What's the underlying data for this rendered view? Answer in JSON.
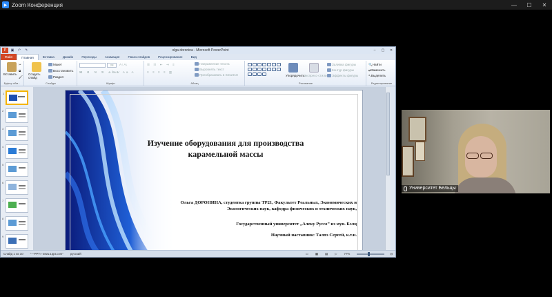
{
  "zoom": {
    "title": "Zoom Конференция",
    "minimize": "—",
    "maximize": "☐",
    "close": "✕"
  },
  "ppt": {
    "title": "olga doronina - Microsoft PowerPoint",
    "tabs": [
      {
        "label": "Файл"
      },
      {
        "label": "Главная"
      },
      {
        "label": "Вставка"
      },
      {
        "label": "Дизайн"
      },
      {
        "label": "Переходы"
      },
      {
        "label": "Анимация"
      },
      {
        "label": "Показ слайдов"
      },
      {
        "label": "Рецензирование"
      },
      {
        "label": "Вид"
      }
    ],
    "ribbon": {
      "paste": "Вставить",
      "create_slide": "Создать слайд",
      "layout": "Макет",
      "reset": "Восстановить",
      "section": "Раздел",
      "font_size": "28",
      "text_direction": "Направление текста",
      "align_text": "Выровнять текст",
      "smartart": "Преобразовать в SmartArt",
      "arrange": "Упорядочить",
      "quick_styles": "Экспресс-стили",
      "shape_fill": "Заливка фигуры",
      "shape_outline": "Контур фигуры",
      "shape_effects": "Эффекты фигуры",
      "find": "Найти",
      "replace": "Заменить",
      "select": "Выделить",
      "groups": {
        "clipboard": "Буфер обм...",
        "slides": "Слайды",
        "font": "Шрифт",
        "paragraph": "Абзац",
        "drawing": "Рисование",
        "editing": "Редактирование"
      }
    },
    "slide": {
      "title": "Изучение оборудования для производства карамельной массы",
      "author": "Ольга ДОРОНИНА, студентка группы TP21, Факультет Реальных, Экономических и Экологических наук, кафедра физических и технических наук,",
      "university": "Государственный университет „Алеку Руссо” из мун. Бэлц",
      "mentor": "Научный наставник: Талпэ Сергей, к.т.н."
    },
    "thumbnails": [
      "1",
      "2",
      "3",
      "4",
      "5",
      "6",
      "7",
      "8",
      "9"
    ],
    "status": {
      "slide_of": "Слайд 1 из 10",
      "theme": "\"—PPT» www.1ppt.com\"",
      "language": "русский",
      "zoom": "77%"
    }
  },
  "camera": {
    "participant": "Университет Бельцы"
  }
}
